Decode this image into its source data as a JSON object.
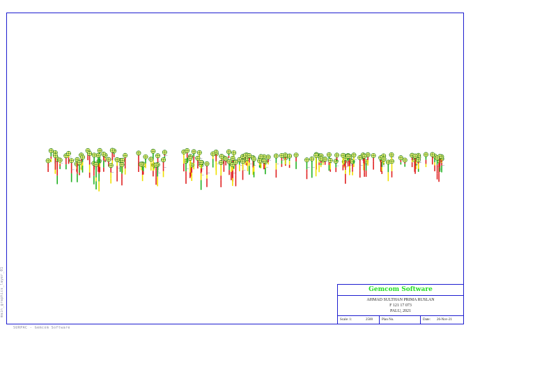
{
  "titleblock": {
    "company": "Gemcom Software",
    "name": "AHMAD SULTHAN PRIMA RUSLAN",
    "id": "F 121 17 073",
    "place": "PALU, 2021",
    "scale_label": "Scale: 1:",
    "scale_value": "2500",
    "plan_label": "Plan No.",
    "date_label": "Date:",
    "date_value": "26-Nov-21"
  },
  "side_label": "main_graphics_layer_01",
  "footer_label": "SURPAC - Gemcom Software",
  "colors": {
    "frame": "#1c1ccf",
    "company": "#22dd22",
    "collar_circle": "#1a7a1a",
    "collar_fill": "#f4f27a",
    "trace_red": "#e02020",
    "trace_yellow": "#f0e000",
    "trace_green": "#20b020",
    "label": "#666688"
  }
}
